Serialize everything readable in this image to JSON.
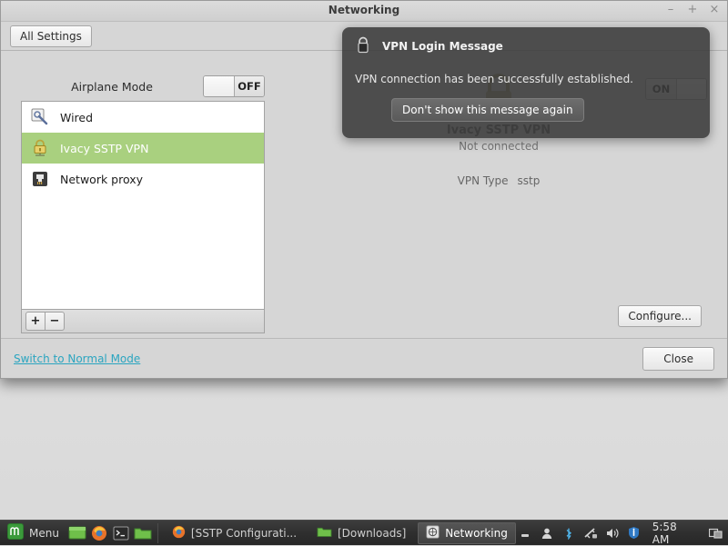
{
  "window": {
    "title": "Networking",
    "controls": {
      "minimize": "–",
      "maximize": "+",
      "close": "×"
    },
    "toolbar": {
      "all_settings_label": "All Settings"
    }
  },
  "content": {
    "airplane": {
      "label": "Airplane Mode",
      "state": "OFF"
    },
    "list": {
      "items": [
        {
          "label": "Wired",
          "icon": "wired-tool-icon",
          "selected": false
        },
        {
          "label": "Ivacy SSTP VPN",
          "icon": "vpn-lock-icon",
          "selected": true
        },
        {
          "label": "Network proxy",
          "icon": "ethernet-jack-icon",
          "selected": false
        }
      ]
    },
    "list_toolbar": {
      "add_label": "+",
      "remove_label": "−"
    },
    "detail": {
      "title": "Ivacy SSTP VPN",
      "status": "Not connected",
      "vpn_type_label": "VPN Type",
      "vpn_type_value": "sstp",
      "toggle_state": "ON",
      "configure_label": "Configure..."
    }
  },
  "bottom_bar": {
    "normal_mode_link": "Switch to Normal Mode",
    "close_label": "Close"
  },
  "notification": {
    "title": "VPN Login Message",
    "icon": "lock-icon",
    "message": "VPN connection has been successfully established.",
    "dismiss_label": "Don't show this message again"
  },
  "taskbar": {
    "menu_label": "Menu",
    "launchers": [
      "show-desktop-icon",
      "firefox-icon",
      "terminal-icon",
      "files-icon"
    ],
    "tasks": [
      {
        "label": "[SSTP Configurati...",
        "icon": "firefox-icon",
        "active": false
      },
      {
        "label": "[Downloads]",
        "icon": "files-icon",
        "active": false
      },
      {
        "label": "Networking",
        "icon": "networking-icon",
        "active": true
      }
    ],
    "tray": [
      "minimize-all-icon",
      "user-icon",
      "bluetooth-icon",
      "network-icon",
      "volume-icon",
      "update-shield-icon"
    ],
    "clock": "5:58 AM",
    "workspace_icon": "workspace-switcher-icon"
  },
  "colors": {
    "selection_green": "#a9d07f",
    "link_cyan": "#2aa5c0",
    "window_bg": "#d6d6d6",
    "notification_bg": "#3a3a3a"
  }
}
